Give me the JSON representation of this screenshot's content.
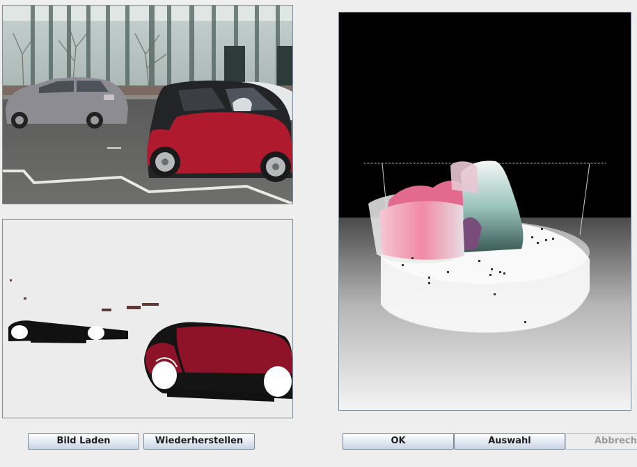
{
  "buttons": {
    "load_image": "Bild Laden",
    "restore": "Wiederherstellen",
    "ok": "OK",
    "selection": "Auswahl",
    "cancel": "Abbrechen"
  },
  "colors": {
    "car_red": "#b01a2e",
    "mask_red": "#8e1228",
    "panel_border": "#7a8a99",
    "button_gradient_top": "#ffffff",
    "button_gradient_bottom": "#c8d4e3"
  }
}
